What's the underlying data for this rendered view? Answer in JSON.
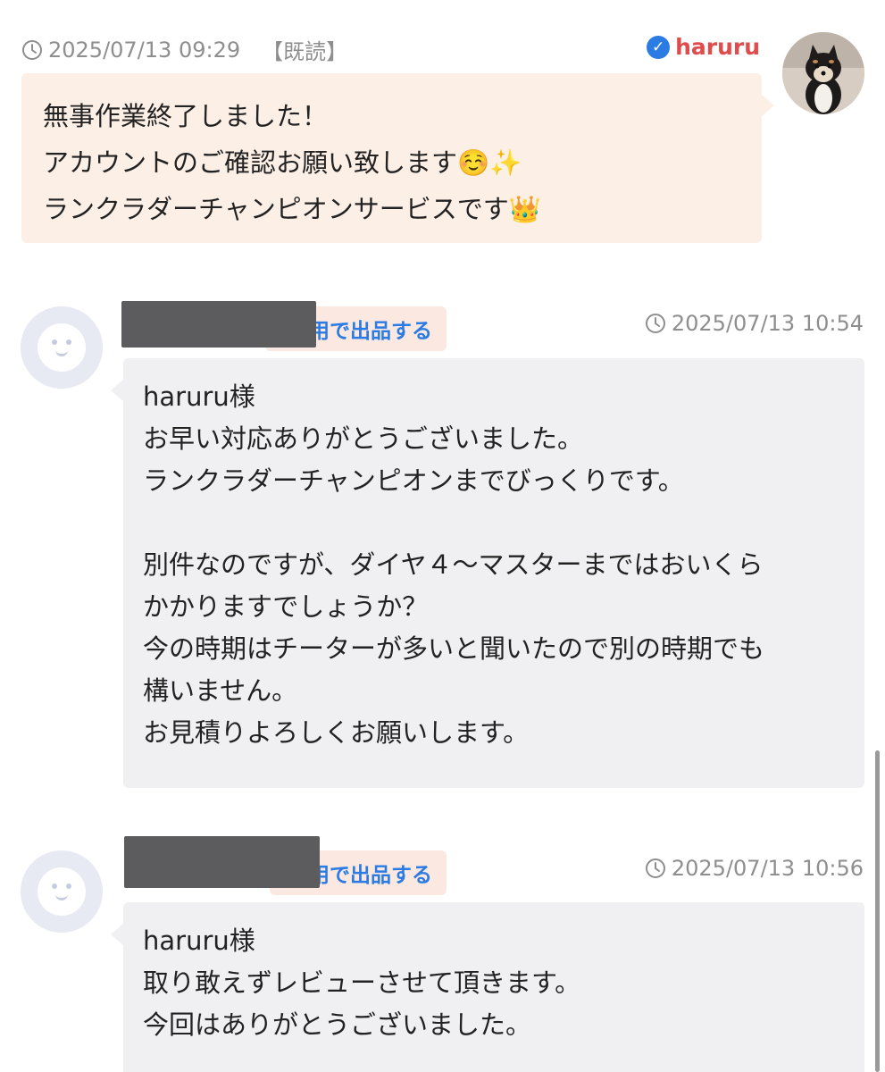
{
  "messages": [
    {
      "sender": "me",
      "timestamp": "2025/07/13 09:29",
      "read_status": "【既読】",
      "username": "haruru",
      "lines": [
        "無事作業終了しました！",
        "アカウントのご確認お願い致します☺️✨",
        "ランクラダーチャンピオンサービスです👑"
      ]
    },
    {
      "sender": "other",
      "tag": "用で出品する",
      "timestamp": "2025/07/13 10:54",
      "lines": [
        "haruru様",
        "お早い対応ありがとうございました。",
        "ランクラダーチャンピオンまでびっくりです。",
        "",
        "別件なのですが、ダイヤ４〜マスターまではおいくら",
        "かかりますでしょうか？",
        "今の時期はチーターが多いと聞いたので別の時期でも",
        "構いません。",
        "お見積りよろしくお願いします。"
      ]
    },
    {
      "sender": "other",
      "tag": "用で出品する",
      "timestamp": "2025/07/13 10:56",
      "lines": [
        "haruru様",
        "取り敢えずレビューさせて頂きます。",
        "今回はありがとうございました。"
      ]
    }
  ],
  "icons": {
    "clock": "clock-icon",
    "verified": "verified-check-icon"
  },
  "colors": {
    "my_bubble": "#fcefe6",
    "other_bubble": "#f0f0f3",
    "username": "#e04b4b",
    "link": "#2a7be4",
    "redaction": "#5c5c5e"
  }
}
